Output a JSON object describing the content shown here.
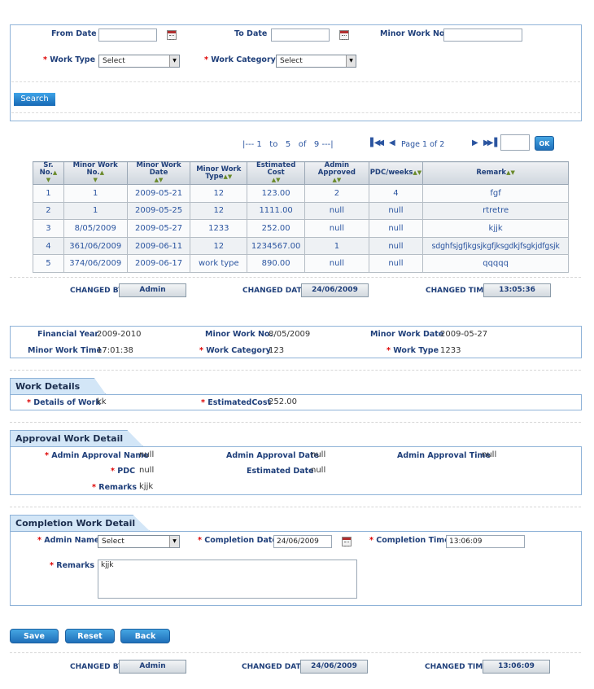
{
  "search": {
    "from_date_label": "From Date",
    "to_date_label": "To Date",
    "minor_work_no_label": "Minor Work No.",
    "work_type_label": "Work Type",
    "work_category_label": "Work Category",
    "work_type_value": "Select",
    "work_category_value": "Select",
    "search_button": "Search"
  },
  "pagination": {
    "range_text": "|--- 1   to   5   of   9 ---|",
    "page_text": "Page 1 of 2",
    "ok_button": "OK"
  },
  "table": {
    "headers": [
      "Sr. No.",
      "Minor Work No.",
      "Minor Work Date",
      "Minor Work Type",
      "Estimated Cost",
      "Admin Approved",
      "PDC/weeks",
      "Remark"
    ],
    "rows": [
      [
        "1",
        "1",
        "2009-05-21",
        "12",
        "123.00",
        "2",
        "4",
        "fgf"
      ],
      [
        "2",
        "1",
        "2009-05-25",
        "12",
        "1111.00",
        "null",
        "null",
        "rtretre"
      ],
      [
        "3",
        "8/05/2009",
        "2009-05-27",
        "1233",
        "252.00",
        "null",
        "null",
        "kjjk"
      ],
      [
        "4",
        "361/06/2009",
        "2009-06-11",
        "12",
        "1234567.00",
        "1",
        "null",
        "sdghfsjgfjkgsjkgfjksgdkjfsgkjdfgsjk"
      ],
      [
        "5",
        "374/06/2009",
        "2009-06-17",
        "work type",
        "890.00",
        "null",
        "null",
        "qqqqq"
      ]
    ]
  },
  "changed_top": {
    "by_label": "CHANGED BY",
    "by_value": "Admin",
    "date_label": "CHANGED DATE",
    "date_value": "24/06/2009",
    "time_label": "CHANGED TIME",
    "time_value": "13:05:36"
  },
  "info": {
    "financial_year_label": "Financial Year",
    "financial_year": "2009-2010",
    "minor_work_no_label": "Minor Work No.",
    "minor_work_no": "8/05/2009",
    "minor_work_date_label": "Minor Work Date",
    "minor_work_date": "2009-05-27",
    "minor_work_time_label": "Minor Work Time",
    "minor_work_time": "17:01:38",
    "work_category_label": "Work Category",
    "work_category": "123",
    "work_type_label": "Work Type",
    "work_type": "1233"
  },
  "work_details": {
    "title": "Work Details",
    "details_label": "Details of Work",
    "details_value": "kk",
    "cost_label": "EstimatedCost",
    "cost_value": "252.00"
  },
  "approval": {
    "title": "Approval Work Detail",
    "admin_name_label": "Admin Approval Name",
    "admin_name": "null",
    "approval_date_label": "Admin Approval Date",
    "approval_date": "null",
    "approval_time_label": "Admin Approval Time",
    "approval_time": "null",
    "pdc_label": "PDC",
    "pdc": "null",
    "est_date_label": "Estimated Date",
    "est_date": "null",
    "remarks_label": "Remarks",
    "remarks": "kjjk"
  },
  "completion": {
    "title": "Completion Work Detail",
    "admin_name_label": "Admin Name",
    "admin_name_value": "Select",
    "completion_date_label": "Completion Date",
    "completion_date": "24/06/2009",
    "completion_time_label": "Completion Time",
    "completion_time": "13:06:09",
    "remarks_label": "Remarks",
    "remarks": "kjjk"
  },
  "actions": {
    "save": "Save",
    "reset": "Reset",
    "back": "Back"
  },
  "changed_bottom": {
    "by_label": "CHANGED BY",
    "by_value": "Admin",
    "date_label": "CHANGED DATE",
    "date_value": "24/06/2009",
    "time_label": "CHANGED TIME",
    "time_value": "13:06:09"
  },
  "colors": {
    "label": "#1f3f7a",
    "border": "#8fb3d8",
    "button": "#1f6fb9",
    "required": "#dd0000"
  }
}
